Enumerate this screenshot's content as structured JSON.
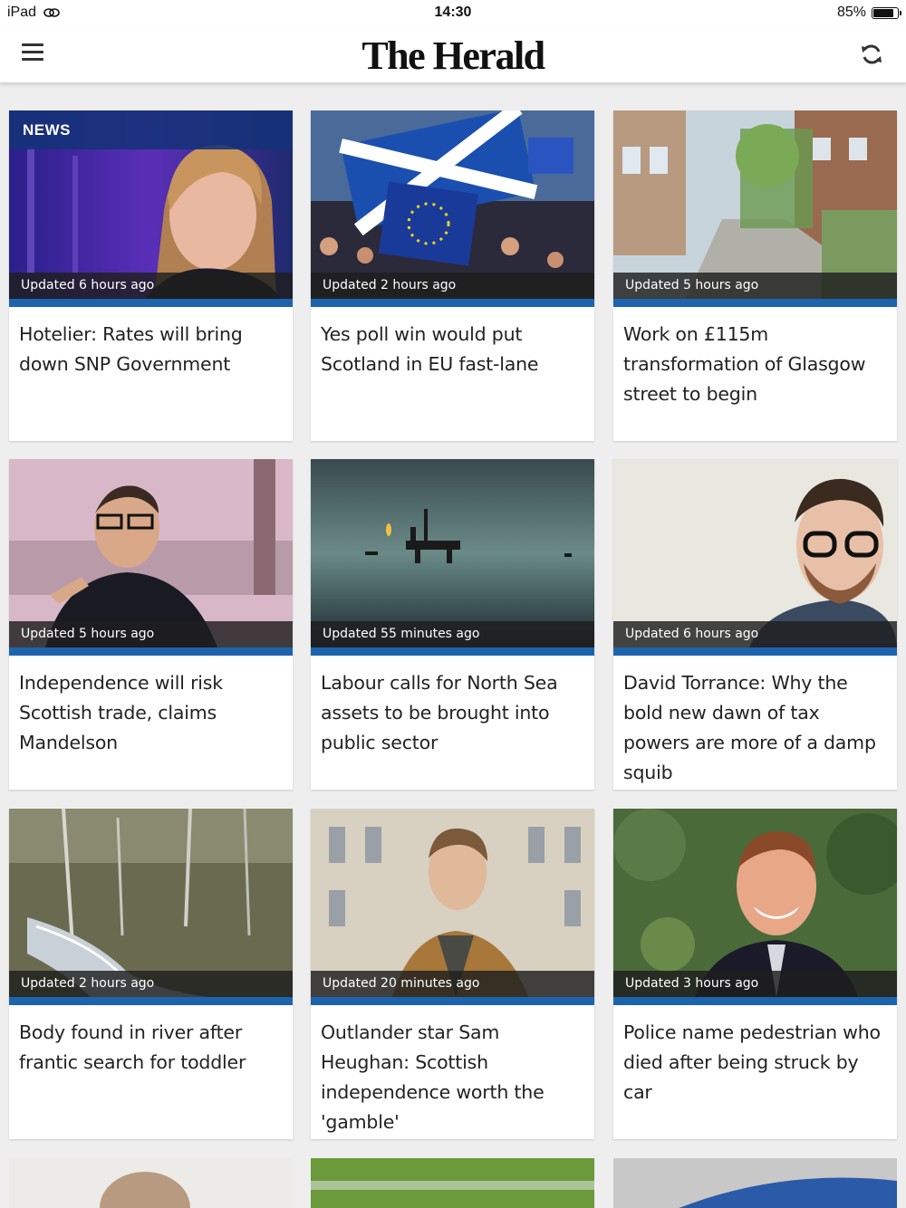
{
  "status_bar": {
    "device": "iPad",
    "time": "14:30",
    "battery": "85%",
    "battery_level": 0.85
  },
  "nav": {
    "logo": "The Herald",
    "menu_icon": "hamburger-menu-icon",
    "refresh_icon": "refresh-icon"
  },
  "colors": {
    "accent": "#1d64ad",
    "section_label_bg": "#14327a"
  },
  "articles": [
    {
      "section": "NEWS",
      "updated": "Updated 6 hours ago",
      "headline": "Hotelier: Rates will bring down SNP Government"
    },
    {
      "updated": "Updated 2 hours ago",
      "headline": "Yes poll win would put Scotland in EU fast-lane"
    },
    {
      "updated": "Updated 5 hours ago",
      "headline": "Work on £115m transformation of Glasgow street to begin"
    },
    {
      "updated": "Updated 5 hours ago",
      "headline": "Independence will risk Scottish trade, claims Mandelson"
    },
    {
      "updated": "Updated 55 minutes ago",
      "headline": "Labour calls for North Sea assets to be brought into public sector"
    },
    {
      "updated": "Updated 6 hours ago",
      "headline": "David Torrance: Why the bold new dawn of tax powers are more of a damp squib"
    },
    {
      "updated": "Updated 2 hours ago",
      "headline": "Body found in river after frantic search for toddler"
    },
    {
      "updated": "Updated 20 minutes ago",
      "headline": "Outlander star Sam Heughan: Scottish independence worth the 'gamble'"
    },
    {
      "updated": "Updated 3 hours ago",
      "headline": "Police name pedestrian who died after being struck by car"
    }
  ]
}
